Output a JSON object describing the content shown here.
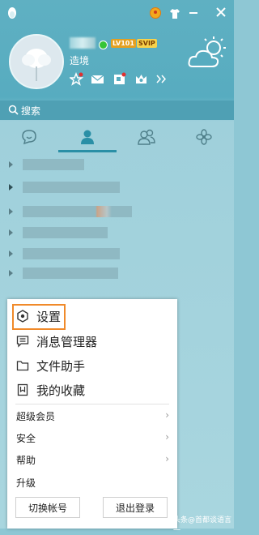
{
  "profile": {
    "signature": "造境",
    "level_badge": "LV101",
    "vip_badge": "SVIP"
  },
  "search": {
    "placeholder": "搜索"
  },
  "tabs": [
    {
      "name": "messages",
      "icon": "chat-bubble-icon"
    },
    {
      "name": "contacts",
      "icon": "person-icon",
      "active": true
    },
    {
      "name": "groups",
      "icon": "group-icon"
    },
    {
      "name": "apps",
      "icon": "flower-icon"
    }
  ],
  "menu": {
    "main_items": [
      {
        "label": "设置",
        "icon": "settings-hexagon-icon",
        "highlighted": true
      },
      {
        "label": "消息管理器",
        "icon": "message-manager-icon"
      },
      {
        "label": "文件助手",
        "icon": "folder-icon"
      },
      {
        "label": "我的收藏",
        "icon": "bookmark-icon"
      }
    ],
    "sub_items": [
      {
        "label": "超级会员",
        "has_submenu": true
      },
      {
        "label": "安全",
        "has_submenu": true
      },
      {
        "label": "帮助",
        "has_submenu": true
      },
      {
        "label": "升级",
        "has_submenu": false
      }
    ],
    "switch_account_label": "切换帐号",
    "logout_label": "退出登录"
  },
  "watermark": "头条@首都谈语言一",
  "colors": {
    "accent": "#f08a2a",
    "panel": "#57acc0"
  }
}
